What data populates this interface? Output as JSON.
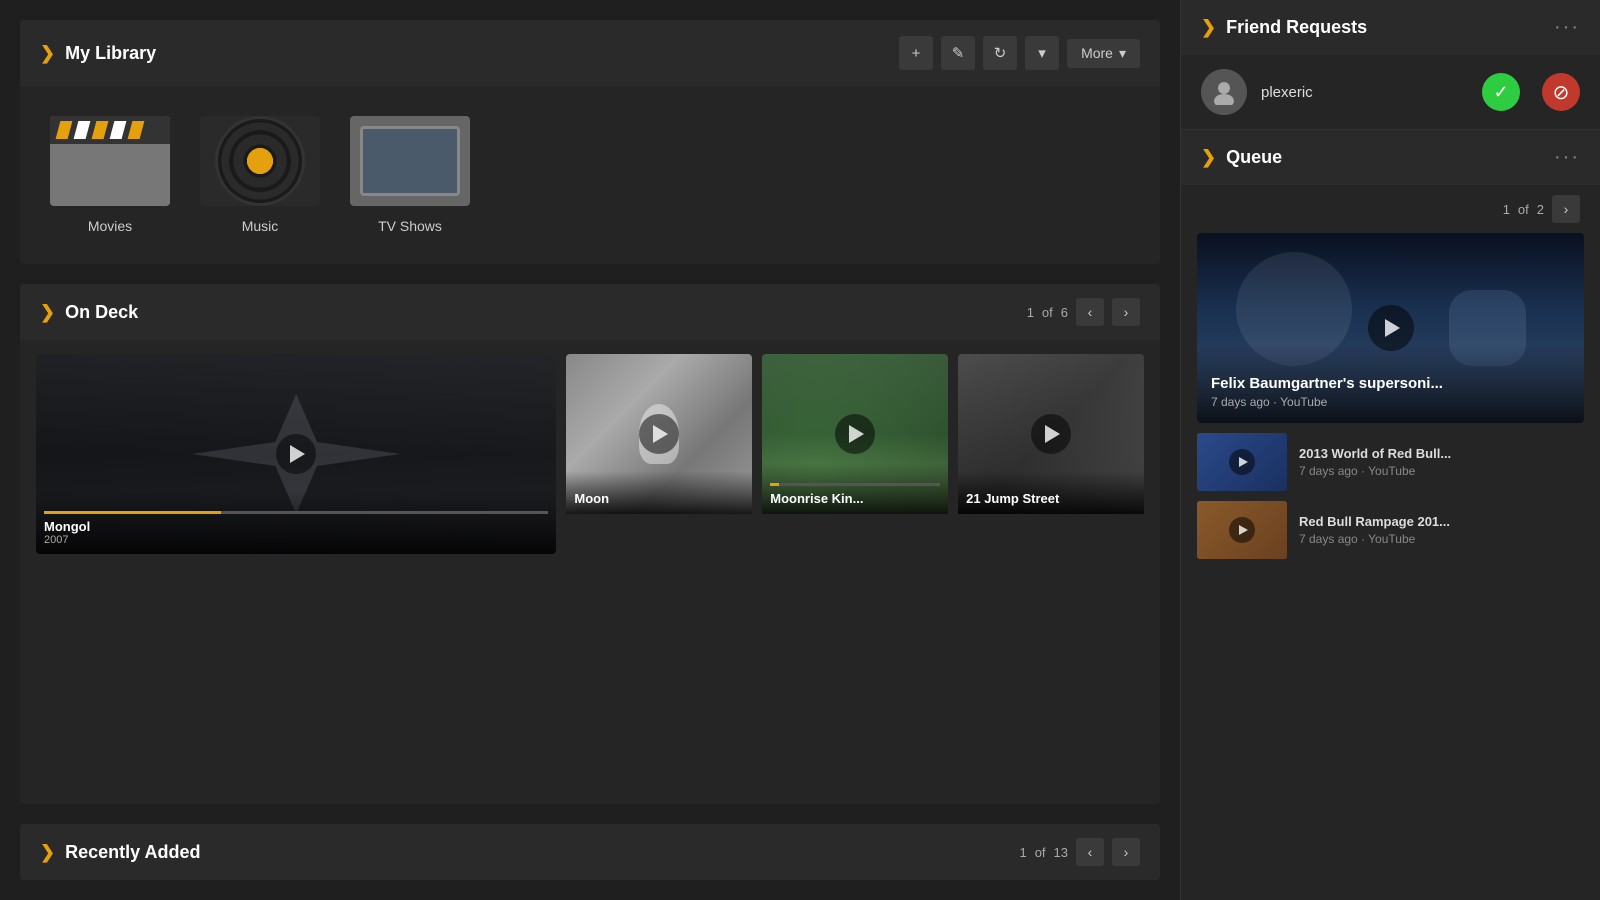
{
  "my_library": {
    "title": "My Library",
    "toolbar": {
      "add_label": "+",
      "edit_label": "✎",
      "refresh_label": "↻",
      "dropdown_label": "▾",
      "more_label": "More",
      "more_arrow": "▾"
    },
    "items": [
      {
        "id": "movies",
        "label": "Movies"
      },
      {
        "id": "music",
        "label": "Music"
      },
      {
        "id": "tv-shows",
        "label": "TV Shows"
      }
    ]
  },
  "on_deck": {
    "title": "On Deck",
    "pagination": {
      "current": "1",
      "of": "of",
      "total": "6"
    },
    "cards": [
      {
        "id": "mongol",
        "title": "Mongol",
        "year": "2007",
        "progress": 35,
        "large": true
      },
      {
        "id": "moon",
        "title": "Moon",
        "year": "",
        "progress": 0,
        "large": false
      },
      {
        "id": "moonrise-kingdom",
        "title": "Moonrise Kin...",
        "year": "",
        "progress": 5,
        "large": false
      },
      {
        "id": "21-jump-street",
        "title": "21 Jump Street",
        "year": "",
        "progress": 0,
        "large": false
      }
    ]
  },
  "recently_added": {
    "title": "Recently Added",
    "pagination": {
      "current": "1",
      "of": "of",
      "total": "13"
    }
  },
  "friend_requests": {
    "title": "Friend Requests",
    "items": [
      {
        "username": "plexeric",
        "accept_label": "✓",
        "decline_label": "⊘"
      }
    ]
  },
  "queue": {
    "title": "Queue",
    "pagination": {
      "current": "1",
      "of": "of",
      "total": "2"
    },
    "featured": {
      "title": "Felix Baumgartner's supersoni...",
      "meta": "7 days ago · YouTube"
    },
    "items": [
      {
        "title": "2013 World of Red Bull...",
        "meta": "7 days ago · YouTube"
      },
      {
        "title": "Red Bull Rampage 201...",
        "meta": "7 days ago · YouTube"
      }
    ]
  }
}
